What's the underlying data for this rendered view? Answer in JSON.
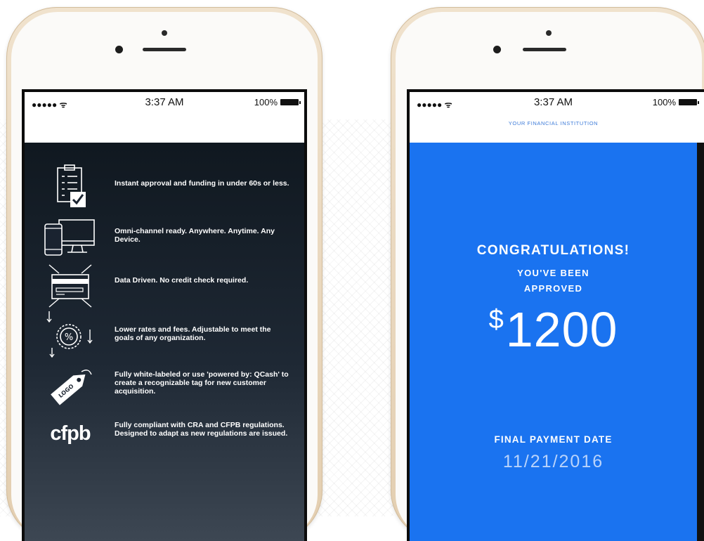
{
  "left_phone": {
    "status": {
      "signal": "●●●●● ᯤ",
      "time": "3:37 AM",
      "battery": "100%"
    },
    "features": [
      {
        "icon": "checklist-icon",
        "text": "Instant approval and funding in under 60s or less."
      },
      {
        "icon": "devices-icon",
        "text": "Omni-channel ready. Anywhere. Anytime. Any Device."
      },
      {
        "icon": "credit-card-icon",
        "text": "Data Driven. No credit check required."
      },
      {
        "icon": "percent-badge-icon",
        "text": "Lower rates and fees. Adjustable to meet the goals of any organization."
      },
      {
        "icon": "logo-tag-icon",
        "text": "Fully white-labeled or use 'powered by: QCash' to create a recognizable tag for new customer acquisition.",
        "tag_text": "LOGO"
      },
      {
        "icon": "cfpb-logo",
        "text": "Fully compliant with CRA and CFPB regulations. Designed to adapt as new regulations are issued.",
        "logo_text": "cfpb"
      }
    ]
  },
  "right_phone": {
    "status": {
      "signal": "●●●●● ᯤ",
      "time": "3:37 AM",
      "battery": "100%"
    },
    "institution": "YOUR FINANCIAL INSTITUTION",
    "congrats": "CONGRATULATIONS!",
    "approved_line1": "YOU'VE BEEN",
    "approved_line2": "APPROVED",
    "currency": "$",
    "amount": "1200",
    "final_label": "FINAL PAYMENT DATE",
    "final_date": "11/21/2016"
  },
  "colors": {
    "blue_screen": "#1a73f0",
    "dark_top": "#101820",
    "phone_gold": "#e9d6bb"
  }
}
